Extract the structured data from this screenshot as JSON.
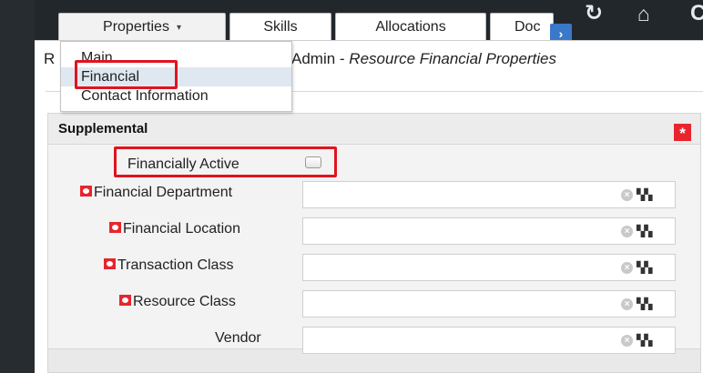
{
  "tabs": {
    "properties": "Properties",
    "skills": "Skills",
    "allocations": "Allocations",
    "docs": "Doc"
  },
  "icons": {
    "caret": "▾",
    "more": "›",
    "refresh": "refresh-icon",
    "home": "home-icon",
    "refresh_glyph": "↻",
    "home_glyph": "⌂",
    "cut_glyph": "C",
    "clear_glyph": "×",
    "lookup_glyph": "▚▚",
    "required_glyph": "*"
  },
  "dropdown": {
    "items": [
      "Main",
      "Financial",
      "Contact Information"
    ]
  },
  "page": {
    "title_prefix": "R",
    "title_visible": "Admin - ",
    "title_italic": "Resource Financial Properties"
  },
  "panel": {
    "title": "Supplemental"
  },
  "fields": {
    "financially_active": {
      "label": "Financially Active",
      "checked": false
    },
    "financial_department": {
      "label": "Financial Department",
      "required": true,
      "value": ""
    },
    "financial_location": {
      "label": "Financial Location",
      "required": true,
      "value": ""
    },
    "transaction_class": {
      "label": "Transaction Class",
      "required": true,
      "value": ""
    },
    "resource_class": {
      "label": "Resource Class",
      "required": true,
      "value": ""
    },
    "vendor": {
      "label": "Vendor",
      "required": false,
      "value": ""
    }
  },
  "colors": {
    "top_bar": "#22272c",
    "highlight": "#e0141e",
    "required": "#e8252c",
    "more_button": "#3a78c9",
    "menu_active": "#dfe8f1"
  }
}
